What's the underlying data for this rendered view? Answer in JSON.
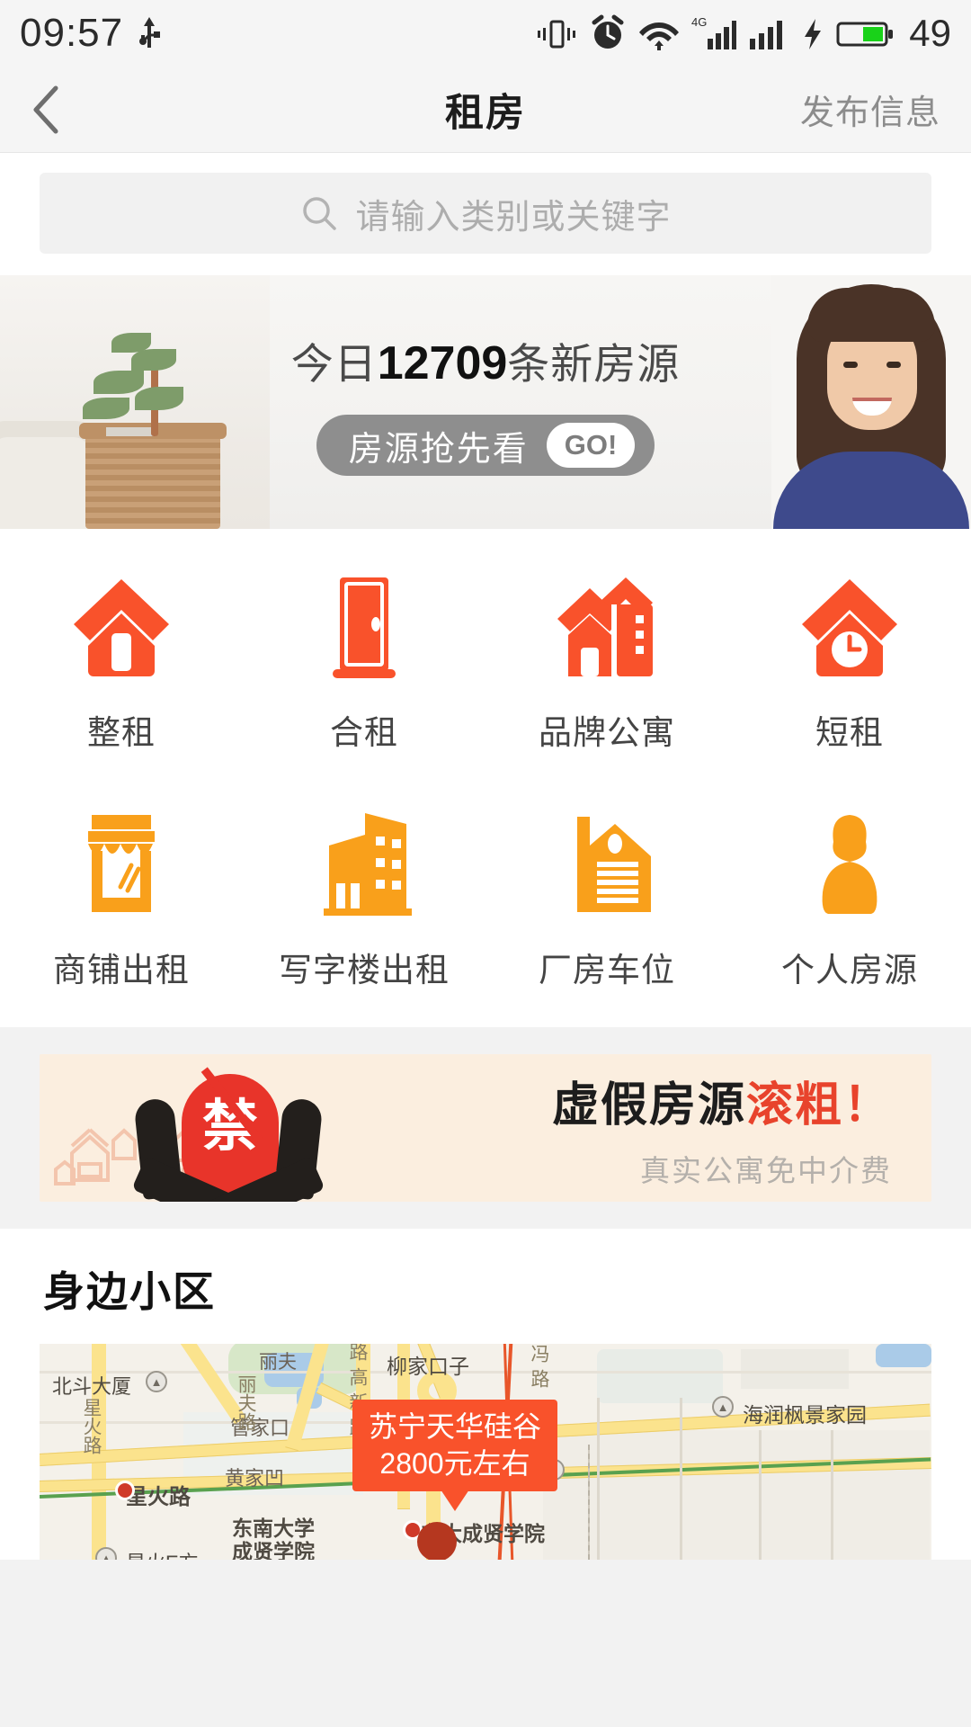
{
  "statusbar": {
    "time": "09:57",
    "battery": "49",
    "icons": [
      "usb-icon",
      "vibrate-icon",
      "alarm-icon",
      "wifi-icon",
      "signal-4g-icon",
      "signal-icon",
      "charging-bolt-icon",
      "battery-icon"
    ]
  },
  "navbar": {
    "back": "‹",
    "title": "租房",
    "action": "发布信息"
  },
  "search": {
    "placeholder": "请输入类别或关键字",
    "icon": "search-icon"
  },
  "hero": {
    "prefix": "今日",
    "count": "12709",
    "suffix": "条新房源",
    "button_label": "房源抢先看",
    "button_go": "GO!"
  },
  "categories": {
    "row1": [
      {
        "label": "整租",
        "icon": "house-icon",
        "color": "#F9522B"
      },
      {
        "label": "合租",
        "icon": "door-icon",
        "color": "#F9522B"
      },
      {
        "label": "品牌公寓",
        "icon": "apartment-icon",
        "color": "#F9522B"
      },
      {
        "label": "短租",
        "icon": "house-clock-icon",
        "color": "#F9522B"
      }
    ],
    "row2": [
      {
        "label": "商铺出租",
        "icon": "shop-icon",
        "color": "#F9A01B"
      },
      {
        "label": "写字楼出租",
        "icon": "office-building-icon",
        "color": "#F9A01B"
      },
      {
        "label": "厂房车位",
        "icon": "warehouse-icon",
        "color": "#F9A01B"
      },
      {
        "label": "个人房源",
        "icon": "person-icon",
        "color": "#F9A01B"
      }
    ]
  },
  "ad": {
    "headline_dark": "虚假房源",
    "headline_red": "滚粗！",
    "subtitle": "真实公寓免中介费",
    "badge_char": "禁"
  },
  "nearby": {
    "title": "身边小区",
    "callout": {
      "name": "苏宁天华硅谷",
      "price": "2800元左右"
    },
    "map_labels": [
      "北斗大厦",
      "星火路",
      "星火路",
      "管家口",
      "黄家凹",
      "柳家口子",
      "东南大学",
      "成贤学院",
      "星火E方",
      "东大成贤学院",
      "海润枫景家园",
      "路",
      "高",
      "新",
      "路",
      "冯",
      "路",
      "丽夫",
      "丽夫路"
    ]
  }
}
